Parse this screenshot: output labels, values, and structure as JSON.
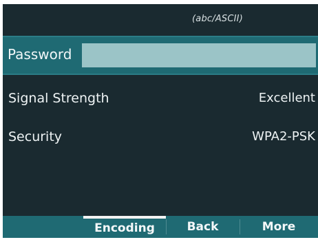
{
  "status_bar": {
    "input_mode": "(abc/ASCII)"
  },
  "password": {
    "label": "Password",
    "value": ""
  },
  "network_info": [
    {
      "label": "Signal Strength",
      "value": "Excellent"
    },
    {
      "label": "Security",
      "value": "WPA2-PSK"
    }
  ],
  "softkeys": [
    {
      "label": "Encoding",
      "selected": true
    },
    {
      "label": "Back",
      "selected": false
    },
    {
      "label": "More",
      "selected": false
    }
  ],
  "colors": {
    "background": "#1a2a30",
    "accent": "#1f6a73",
    "input_fill": "#9bc4c7",
    "text": "#eef3f4"
  }
}
